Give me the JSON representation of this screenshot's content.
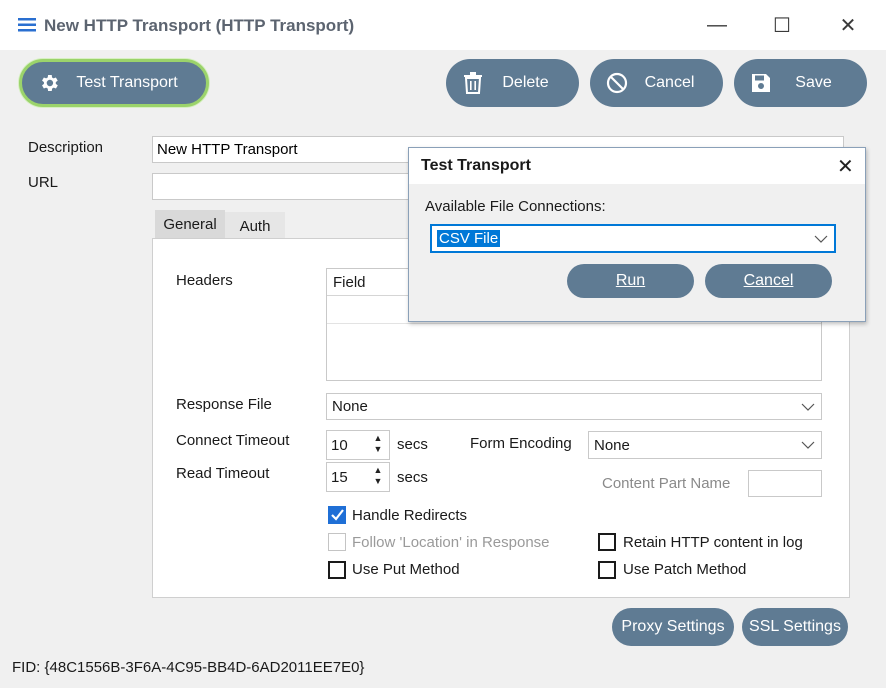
{
  "window": {
    "title": "New HTTP Transport (HTTP Transport)",
    "minimize_glyph": "—",
    "maximize_glyph": "☐",
    "close_glyph": "✕"
  },
  "toolbar": {
    "test_transport": "Test Transport",
    "delete": "Delete",
    "cancel": "Cancel",
    "save": "Save"
  },
  "form": {
    "description_label": "Description",
    "description_value": "New HTTP Transport",
    "url_label": "URL",
    "url_value": "",
    "tabs": [
      "General",
      "Auth"
    ],
    "headers_label": "Headers",
    "headers_column": "Field",
    "response_file_label": "Response File",
    "response_file_value": "None",
    "connect_timeout_label": "Connect Timeout",
    "connect_timeout_value": "10",
    "read_timeout_label": "Read Timeout",
    "read_timeout_value": "15",
    "secs": "secs",
    "form_encoding_label": "Form Encoding",
    "form_encoding_value": "None",
    "content_part_name_label": "Content Part Name",
    "content_part_name_value": "",
    "checkboxes": {
      "handle_redirects": "Handle Redirects",
      "follow_location": "Follow 'Location' in Response",
      "use_put": "Use Put Method",
      "retain_http": "Retain HTTP content in log",
      "use_patch": "Use Patch Method"
    }
  },
  "bottom": {
    "proxy_settings": "Proxy Settings",
    "ssl_settings": "SSL Settings",
    "fid": "FID: {48C1556B-3F6A-4C95-BB4D-6AD2011EE7E0}"
  },
  "dialog": {
    "title": "Test Transport",
    "close_glyph": "✕",
    "available_label": "Available File Connections:",
    "selected_connection": "CSV File",
    "run": "Run",
    "cancel": "Cancel"
  },
  "colors": {
    "button": "#5f7b93",
    "focus_green": "#9bd36b",
    "checkbox_on": "#1f6fd6",
    "selection": "#0078d7"
  }
}
